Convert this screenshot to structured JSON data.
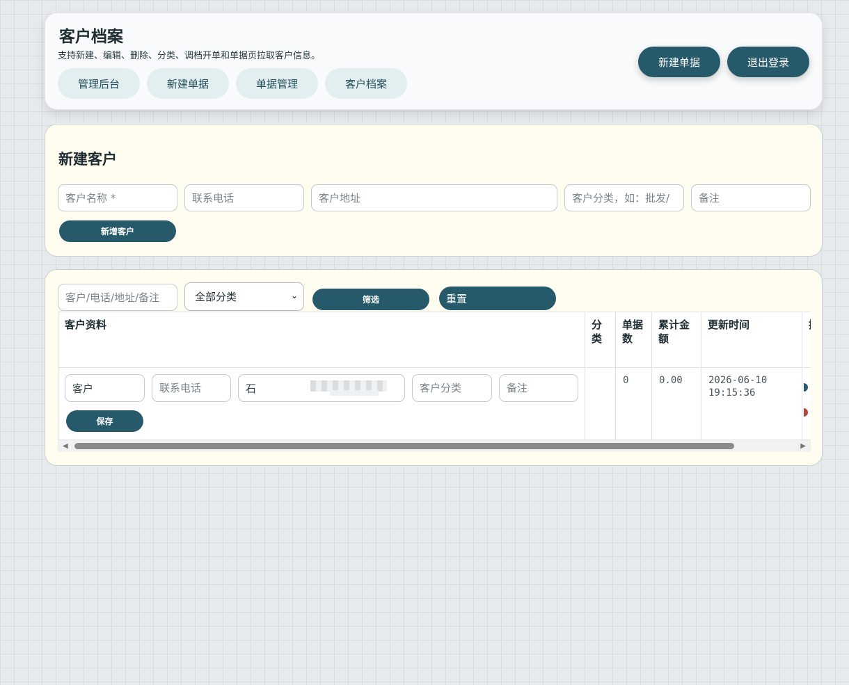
{
  "header": {
    "title": "客户档案",
    "subtitle": "支持新建、编辑、删除、分类、调档开单和单据页拉取客户信息。",
    "nav": [
      "管理后台",
      "新建单据",
      "单据管理",
      "客户档案"
    ],
    "actions": {
      "new_order": "新建单据",
      "logout": "退出登录"
    }
  },
  "new_customer": {
    "title": "新建客户",
    "fields": {
      "name_placeholder": "客户名称 *",
      "phone_placeholder": "联系电话",
      "address_placeholder": "客户地址",
      "category_placeholder": "客户分类，如：批发/",
      "note_placeholder": "备注"
    },
    "add_button": "新增客户"
  },
  "filter": {
    "search_placeholder": "客户/电话/地址/备注",
    "category_selected": "全部分类",
    "filter_button": "筛选",
    "reset_button": "重置"
  },
  "table": {
    "headers": [
      "客户资料",
      "分类",
      "单据数",
      "累计金额",
      "更新时间",
      "操"
    ],
    "rows": [
      {
        "name": "客户",
        "phone_placeholder": "联系电话",
        "address_visible_char": "石",
        "category_placeholder": "客户分类",
        "note_placeholder": "备注",
        "save_label": "保存",
        "category": "",
        "order_count": "0",
        "total_amount": "0.00",
        "updated_at": "2026-06-10 19:15:36"
      }
    ]
  },
  "colors": {
    "accent": "#265a6b",
    "pill": "#e3eef0",
    "panel": "#fffdf0"
  }
}
